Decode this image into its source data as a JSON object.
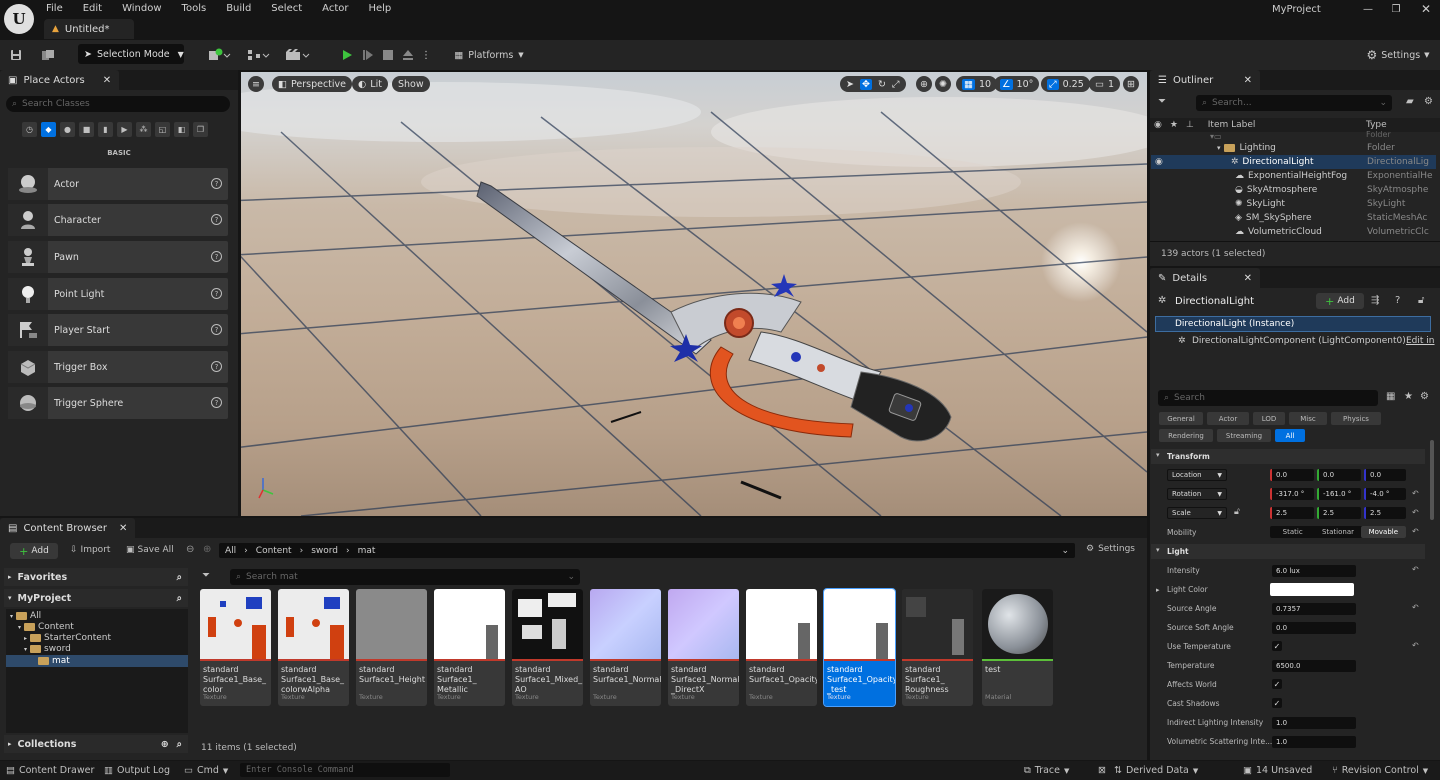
{
  "app": {
    "project_name": "MyProject",
    "document_tab": "Untitled*"
  },
  "menu": [
    "File",
    "Edit",
    "Window",
    "Tools",
    "Build",
    "Select",
    "Actor",
    "Help"
  ],
  "toolbar": {
    "selection_mode": "Selection Mode",
    "platforms": "Platforms",
    "settings": "Settings"
  },
  "place_actors": {
    "tab_label": "Place Actors",
    "search_placeholder": "Search Classes",
    "category_label": "BASIC",
    "items": [
      "Actor",
      "Character",
      "Pawn",
      "Point Light",
      "Player Start",
      "Trigger Box",
      "Trigger Sphere"
    ]
  },
  "viewport": {
    "perspective": "Perspective",
    "lit": "Lit",
    "show": "Show",
    "grid_snap": "10",
    "rotation_snap": "10°",
    "scale_snap": "0.25",
    "camera_speed": "1"
  },
  "outliner": {
    "tab_label": "Outliner",
    "search_placeholder": "Search...",
    "col_label": "Item Label",
    "col_type": "Type",
    "rows": [
      {
        "label": "Lighting",
        "type": "Folder"
      },
      {
        "label": "DirectionalLight",
        "type": "DirectionalLig"
      },
      {
        "label": "ExponentialHeightFog",
        "type": "ExponentialHe"
      },
      {
        "label": "SkyAtmosphere",
        "type": "SkyAtmosphe"
      },
      {
        "label": "SkyLight",
        "type": "SkyLight"
      },
      {
        "label": "SM_SkySphere",
        "type": "StaticMeshAc"
      },
      {
        "label": "VolumetricCloud",
        "type": "VolumetricClc"
      }
    ],
    "status": "139 actors (1 selected)"
  },
  "details": {
    "tab_label": "Details",
    "actor_name": "DirectionalLight",
    "add_label": "Add",
    "instance_label": "DirectionalLight (Instance)",
    "component_label": "DirectionalLightComponent (LightComponent0)",
    "edit_in": "Edit in",
    "search_placeholder": "Search",
    "categories": [
      "General",
      "Actor",
      "LOD",
      "Misc",
      "Physics",
      "Rendering",
      "Streaming",
      "All"
    ],
    "transform_label": "Transform",
    "location_label": "Location",
    "location": [
      "0.0",
      "0.0",
      "0.0"
    ],
    "rotation_label": "Rotation",
    "rotation": [
      "-317.0 °",
      "-161.0 °",
      "-4.0 °"
    ],
    "scale_label": "Scale",
    "scale": [
      "2.5",
      "2.5",
      "2.5"
    ],
    "mobility_label": "Mobility",
    "mobility_options": [
      "Static",
      "Stationar",
      "Movable"
    ],
    "light_label": "Light",
    "intensity_label": "Intensity",
    "intensity": "6.0 lux",
    "light_color_label": "Light Color",
    "source_angle_label": "Source Angle",
    "source_angle": "0.7357",
    "source_soft_angle_label": "Source Soft Angle",
    "source_soft_angle": "0.0",
    "use_temperature_label": "Use Temperature",
    "temperature_label": "Temperature",
    "temperature": "6500.0",
    "affects_world_label": "Affects World",
    "cast_shadows_label": "Cast Shadows",
    "indirect_label": "Indirect Lighting Intensity",
    "indirect": "1.0",
    "volumetric_label": "Volumetric Scattering Inte...",
    "volumetric": "1.0"
  },
  "content_browser": {
    "tab_label": "Content Browser",
    "add": "Add",
    "import": "Import",
    "save_all": "Save All",
    "path": [
      "All",
      "Content",
      "sword",
      "mat"
    ],
    "settings": "Settings",
    "favorites": "Favorites",
    "project": "MyProject",
    "search_placeholder": "Search mat",
    "tree": [
      "All",
      "Content",
      "StarterContent",
      "sword",
      "mat"
    ],
    "collections": "Collections",
    "count": "11 items (1 selected)",
    "assets": [
      {
        "name": "standard Surface1_Base_ color",
        "type": "Texture"
      },
      {
        "name": "standard Surface1_Base_ colorwAlpha",
        "type": "Texture"
      },
      {
        "name": "standard Surface1_Height",
        "type": "Texture"
      },
      {
        "name": "standard Surface1_ Metallic",
        "type": "Texture"
      },
      {
        "name": "standard Surface1_Mixed_ AO",
        "type": "Texture"
      },
      {
        "name": "standard Surface1_Normal",
        "type": "Texture"
      },
      {
        "name": "standard Surface1_Normal _DirectX",
        "type": "Texture"
      },
      {
        "name": "standard Surface1_Opacity",
        "type": "Texture"
      },
      {
        "name": "standard Surface1_Opacity _test",
        "type": "Texture"
      },
      {
        "name": "standard Surface1_ Roughness",
        "type": "Texture"
      },
      {
        "name": "test",
        "type": "Material"
      }
    ]
  },
  "statusbar": {
    "content_drawer": "Content Drawer",
    "output_log": "Output Log",
    "cmd": "Cmd",
    "console_placeholder": "Enter Console Command",
    "trace": "Trace",
    "derived_data": "Derived Data",
    "unsaved": "14 Unsaved",
    "revision_control": "Revision Control"
  },
  "colors": {
    "accent": "#0070e0",
    "selected_row": "#1f3a5a",
    "play_green": "#3ec43e"
  }
}
